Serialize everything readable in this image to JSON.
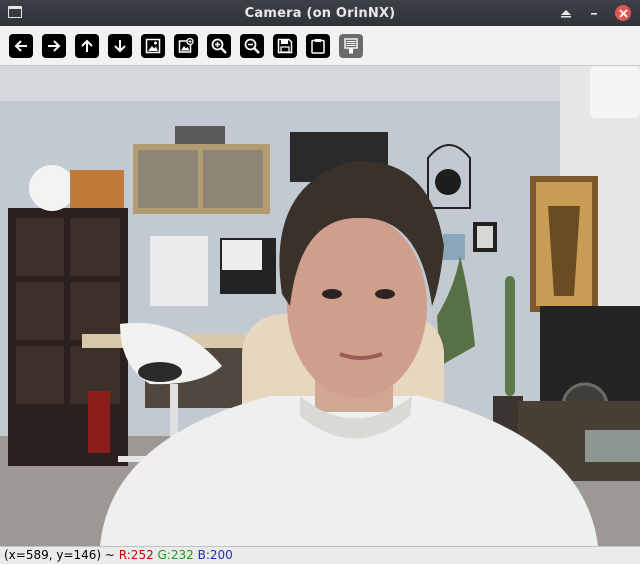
{
  "window": {
    "title": "Camera (on OrinNX)"
  },
  "toolbar": {
    "buttons": [
      {
        "icon": "arrow-left-icon",
        "name": "pan-left-button"
      },
      {
        "icon": "arrow-right-icon",
        "name": "pan-right-button"
      },
      {
        "icon": "arrow-up-icon",
        "name": "pan-up-button"
      },
      {
        "icon": "arrow-down-icon",
        "name": "pan-down-button"
      },
      {
        "icon": "zoom-fit-icon",
        "name": "zoom-fit-button"
      },
      {
        "icon": "zoom-original-icon",
        "name": "zoom-original-button"
      },
      {
        "icon": "zoom-in-icon",
        "name": "zoom-in-button"
      },
      {
        "icon": "zoom-out-icon",
        "name": "zoom-out-button"
      },
      {
        "icon": "save-icon",
        "name": "save-button"
      },
      {
        "icon": "clipboard-icon",
        "name": "copy-clipboard-button"
      },
      {
        "icon": "properties-icon",
        "name": "properties-button",
        "disabled": true
      }
    ]
  },
  "status": {
    "coords": "(x=589, y=146) ~ ",
    "r": "R:252",
    "g": "G:232",
    "b": "B:200"
  },
  "colors": {
    "titlebar": "#33363c",
    "toolbar": "#f2f2f2",
    "close_button": "#e05552",
    "status_r": "#d00000",
    "status_g": "#15a015",
    "status_b": "#1a2fc7"
  }
}
